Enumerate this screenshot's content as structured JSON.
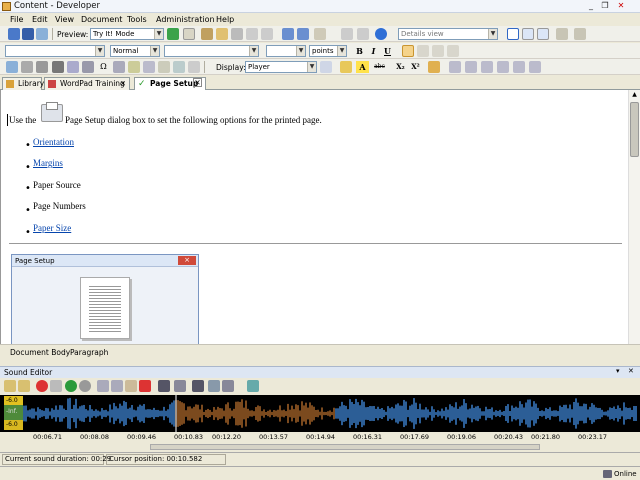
{
  "window": {
    "title": "Content - Developer"
  },
  "menu": [
    "File",
    "Edit",
    "View",
    "Document",
    "Tools",
    "Administration",
    "Help"
  ],
  "toolbar1": {
    "preview_label": "Preview:",
    "preview_mode": "Try It! Mode",
    "view_mode": "Details view"
  },
  "toolbar2": {
    "style": "Normal",
    "size_unit": "points"
  },
  "toolbar3": {
    "display_label": "Display:",
    "display_value": "Player"
  },
  "tabs": [
    {
      "label": "Library"
    },
    {
      "label": "WordPad Training"
    },
    {
      "label": "Page Setup"
    }
  ],
  "doc": {
    "intro_before": "Use the",
    "intro_after": "Page Setup dialog box to set the following options for the printed page.",
    "items": [
      {
        "text": "Orientation",
        "link": true
      },
      {
        "text": "Margins",
        "link": true
      },
      {
        "text": "Paper Source",
        "link": false
      },
      {
        "text": "Page Numbers",
        "link": false
      },
      {
        "text": "Paper Size",
        "link": true
      }
    ],
    "dialog_title": "Page Setup",
    "dialog_close": "×"
  },
  "doc_status": {
    "body": "Document Body",
    "paragraph": "Paragraph"
  },
  "sound": {
    "title": "Sound Editor",
    "db_labels": [
      "-6.0",
      "-Inf.",
      "-6.0"
    ],
    "ticks": [
      "00:06.71",
      "00:08.08",
      "00:09.46",
      "00:10.83",
      "00:12.20",
      "00:13.57",
      "00:14.94",
      "00:16.31",
      "00:17.69",
      "00:19.06",
      "00:20.43",
      "00:21.80",
      "00:23.17"
    ],
    "duration": "Current sound duration: 00:29",
    "cursor": "Cursor position: 00:10.582"
  },
  "status": {
    "online": "Online"
  },
  "colors": {
    "wave_blue": "#3f86d6",
    "wave_brown": "#b06a2c",
    "link": "#0645ad"
  }
}
